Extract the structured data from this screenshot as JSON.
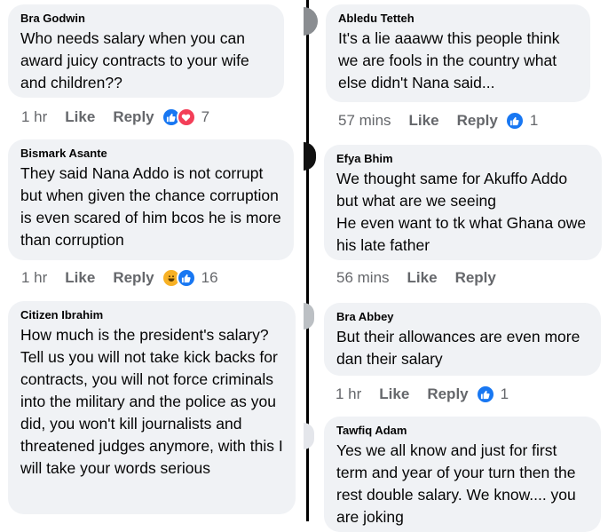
{
  "colors": {
    "bubble": "#f0f2f5",
    "meta": "#65676b",
    "like": "#1877f2",
    "love": "#f33e58",
    "haha": "#f7b125"
  },
  "left": [
    {
      "name": "Bra Godwin",
      "text": "Who needs salary when you can award juicy contracts to your wife and children??",
      "time": "1 hr",
      "like": "Like",
      "reply": "Reply",
      "reactions": [
        "like-icon",
        "love-icon"
      ],
      "count": "7"
    },
    {
      "name": "Bismark Asante",
      "text": "They said Nana Addo is not corrupt but when given the chance corruption is even scared of him bcos he is more than corruption",
      "time": "1 hr",
      "like": "Like",
      "reply": "Reply",
      "reactions": [
        "haha-icon",
        "like-icon"
      ],
      "count": "16"
    },
    {
      "name": "Citizen Ibrahim",
      "text": "How much is the president's salary? Tell us you will not take kick backs for contracts, you will not force criminals into the military and the police as you did, you won't kill journalists and threatened judges anymore, with this I will take your words serious"
    }
  ],
  "right": [
    {
      "name": "Abledu Tetteh",
      "text": "It's a lie  aaaww this people think we are fools in the country what else didn't Nana said...",
      "time": "57 mins",
      "like": "Like",
      "reply": "Reply",
      "reactions": [
        "like-icon"
      ],
      "count": "1"
    },
    {
      "name": "Efya Bhim",
      "text": "We thought same for Akuffo Addo but what are we seeing\nHe even want to tk what Ghana owe his late father",
      "time": "56 mins",
      "like": "Like",
      "reply": "Reply"
    },
    {
      "name": "Bra Abbey",
      "text": "But their allowances are even more dan their salary",
      "time": "1 hr",
      "like": "Like",
      "reply": "Reply",
      "reactions": [
        "like-icon"
      ],
      "count": "1"
    },
    {
      "name": "Tawfiq Adam",
      "text": "Yes we all know and just for first term and year of your turn then the rest double salary. We know.... you are joking"
    }
  ]
}
